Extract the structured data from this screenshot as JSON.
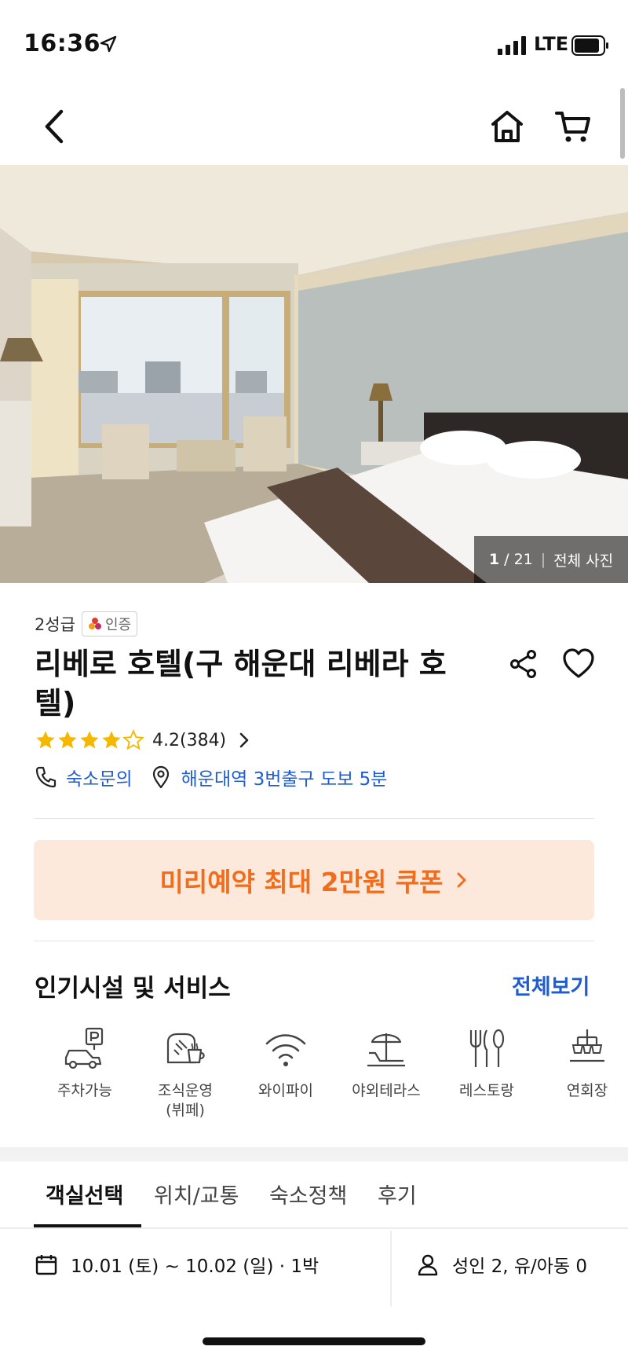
{
  "status_bar": {
    "time": "16:36",
    "network": "LTE"
  },
  "hero": {
    "current_photo": "1",
    "total_photos": "21",
    "all_photos_label": "전체 사진"
  },
  "hotel": {
    "grade": "2성급",
    "cert_label": "인증",
    "name": "리베로 호텔(구 해운대 리베라 호텔)",
    "rating": 4.2,
    "rating_text": "4.2(384)",
    "stars_filled": 4,
    "contact_label": "숙소문의",
    "location_label": "해운대역 3번출구 도보 5분"
  },
  "coupon": {
    "label": "미리예약 최대 2만원 쿠폰"
  },
  "facilities": {
    "title": "인기시설 및 서비스",
    "view_all_label": "전체보기",
    "items": [
      {
        "label": "주차가능",
        "icon": "parking-icon"
      },
      {
        "label": "조식운영\n(뷔페)",
        "icon": "breakfast-icon"
      },
      {
        "label": "와이파이",
        "icon": "wifi-icon"
      },
      {
        "label": "야외테라스",
        "icon": "terrace-icon"
      },
      {
        "label": "레스토랑",
        "icon": "restaurant-icon"
      },
      {
        "label": "연회장",
        "icon": "banquet-icon"
      }
    ]
  },
  "tabs": [
    "객실선택",
    "위치/교통",
    "숙소정책",
    "후기"
  ],
  "booking": {
    "dates": "10.01 (토) ~ 10.02 (일) · 1박",
    "guests": "성인 2, 유/아동 0"
  },
  "colors": {
    "accent_blue": "#1e5ccf",
    "coupon_orange": "#ef6d1d",
    "coupon_bg": "#fde9dc",
    "star": "#f5b800"
  }
}
